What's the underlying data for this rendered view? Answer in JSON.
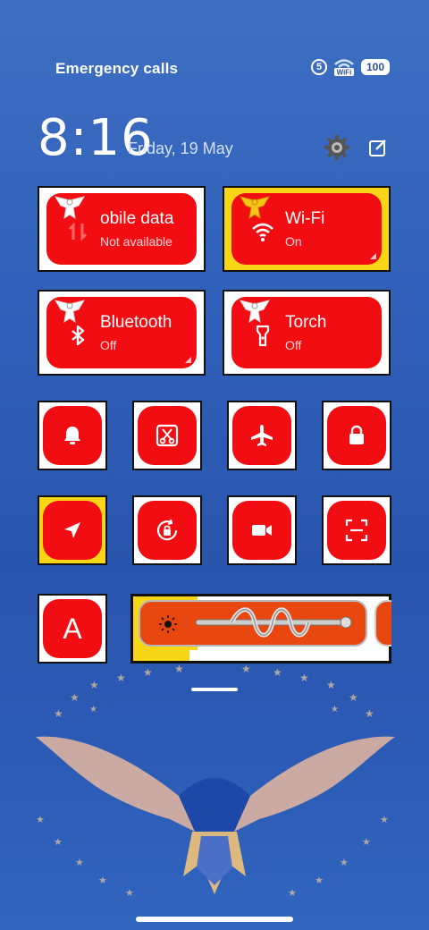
{
  "status_bar": {
    "left_text": "Emergency calls",
    "sim_number": "5",
    "wifi_badge": "WiFi",
    "battery": "100"
  },
  "header": {
    "time": "8:16",
    "date": "Friday, 19 May"
  },
  "big_tiles": [
    {
      "label": "obile data",
      "sub": "Not available",
      "icon": "mobile-data-icon"
    },
    {
      "label": "Wi-Fi",
      "sub": "On",
      "icon": "wifi-icon"
    },
    {
      "label": "Bluetooth",
      "sub": "Off",
      "icon": "bluetooth-icon"
    },
    {
      "label": "Torch",
      "sub": "Off",
      "icon": "torch-icon"
    }
  ],
  "small_tiles": [
    {
      "icon": "bell-icon"
    },
    {
      "icon": "screenshot-icon"
    },
    {
      "icon": "airplane-icon"
    },
    {
      "icon": "lock-icon"
    },
    {
      "icon": "location-icon"
    },
    {
      "icon": "rotation-lock-icon"
    },
    {
      "icon": "video-icon"
    },
    {
      "icon": "scan-icon"
    },
    {
      "icon": "font-icon",
      "letter": "A"
    }
  ],
  "brightness": {
    "icon": "sun-icon"
  },
  "colors": {
    "tile_red": "#f20d12",
    "tile_yellow": "#f7d617",
    "background_blue": "#2f5fb8",
    "slider_orange": "#e8470f"
  }
}
